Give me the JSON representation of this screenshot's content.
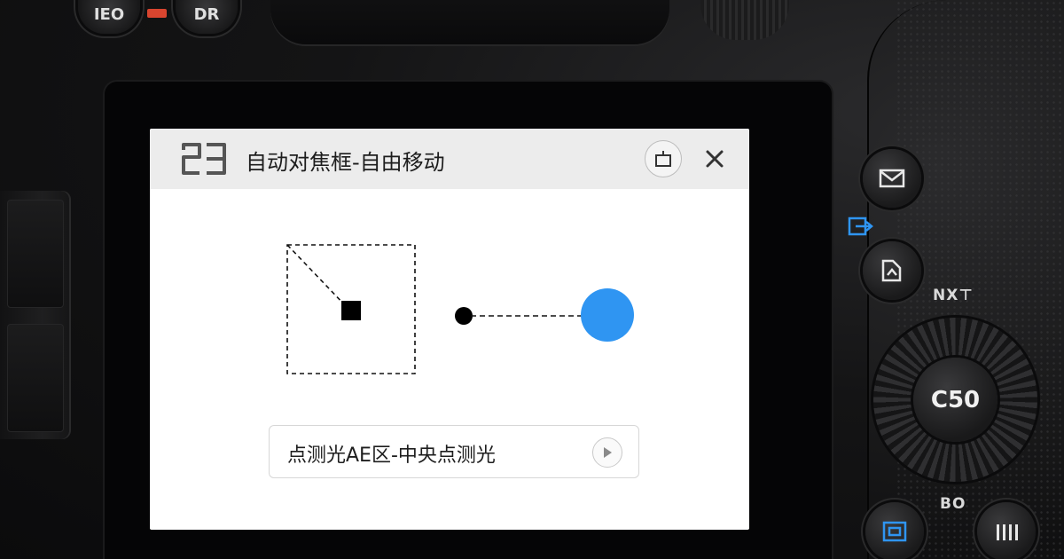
{
  "dialog": {
    "title": "自动对焦框-自由移动",
    "app_icon": "af-frame-icon",
    "header_button_icon": "camera-icon",
    "close_icon": "close-icon"
  },
  "metering": {
    "label": "点测光AE区-中央点测光",
    "arrow_icon": "play-arrow-icon"
  },
  "camera": {
    "dial_label": "C50",
    "right_labels": [
      "NX⊤",
      "BO"
    ],
    "top_buttons": [
      "IEO",
      "DR"
    ],
    "accent_color": "#2f95f2"
  },
  "colors": {
    "accent": "#2f95f2",
    "header_bg": "#ececec",
    "dialog_bg": "#ffffff"
  }
}
